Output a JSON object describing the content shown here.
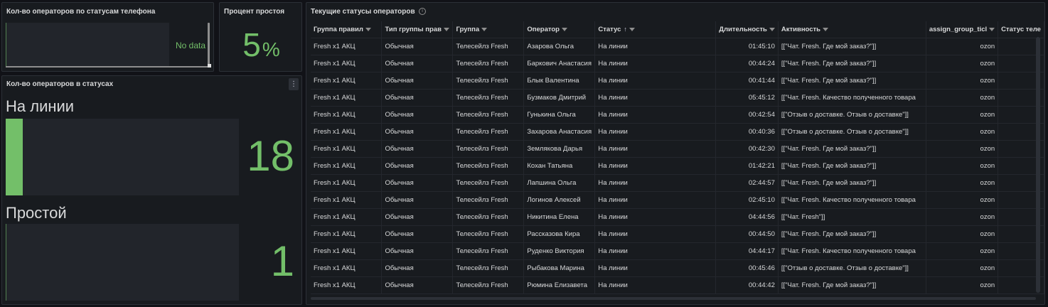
{
  "panel_phone_status": {
    "title": "Кол-во операторов по статусам телефона",
    "no_data": "No data"
  },
  "panel_idle": {
    "title": "Процент простоя",
    "value": "5",
    "unit": "%"
  },
  "panel_status_counts": {
    "title": "Кол-во операторов в статусах",
    "menu": "⋮",
    "items": [
      {
        "label": "На линии",
        "value": "18",
        "fill_fraction": 1.0
      },
      {
        "label": "Простой",
        "value": "1",
        "fill_fraction": 0.0
      }
    ],
    "accent": "#73bf69"
  },
  "panel_table": {
    "title": "Текущие статусы операторов",
    "info": "i",
    "columns": [
      "Группа правил",
      "Тип группы прав",
      "Группа",
      "Оператор",
      "Статус",
      "Длительность",
      "Активность",
      "assign_group_ticl",
      "Статус теле"
    ],
    "rows": [
      [
        "Fresh x1 АКЦ",
        "Обычная",
        "Телесейлз Fresh",
        "Азарова Ольга",
        "На линии",
        "01:45:10",
        "[[\"Чат. Fresh. Где мой заказ?\"]]",
        "ozon",
        ""
      ],
      [
        "Fresh x1 АКЦ",
        "Обычная",
        "Телесейлз Fresh",
        "Баркович Анастасия",
        "На линии",
        "00:44:24",
        "[[\"Чат. Fresh. Где мой заказ?\"]]",
        "ozon",
        ""
      ],
      [
        "Fresh x1 АКЦ",
        "Обычная",
        "Телесейлз Fresh",
        "Блык Валентина",
        "На линии",
        "00:41:44",
        "[[\"Чат. Fresh. Где мой заказ?\"]]",
        "ozon",
        ""
      ],
      [
        "Fresh x1 АКЦ",
        "Обычная",
        "Телесейлз Fresh",
        "Бузмаков Дмитрий",
        "На линии",
        "05:45:12",
        "[[\"Чат. Fresh. Качество полученного товара",
        "ozon",
        ""
      ],
      [
        "Fresh x1 АКЦ",
        "Обычная",
        "Телесейлз Fresh",
        "Гунькина Ольга",
        "На линии",
        "00:42:54",
        "[[\"Отзыв о доставке. Отзыв о доставке\"]]",
        "ozon",
        ""
      ],
      [
        "Fresh x1 АКЦ",
        "Обычная",
        "Телесейлз Fresh",
        "Захарова Анастасия",
        "На линии",
        "00:40:36",
        "[[\"Отзыв о доставке. Отзыв о доставке\"]]",
        "ozon",
        ""
      ],
      [
        "Fresh x1 АКЦ",
        "Обычная",
        "Телесейлз Fresh",
        "Землякова Дарья",
        "На линии",
        "00:42:30",
        "[[\"Чат. Fresh. Где мой заказ?\"]]",
        "ozon",
        ""
      ],
      [
        "Fresh x1 АКЦ",
        "Обычная",
        "Телесейлз Fresh",
        "Кохан Татьяна",
        "На линии",
        "01:42:21",
        "[[\"Чат. Fresh. Где мой заказ?\"]]",
        "ozon",
        ""
      ],
      [
        "Fresh x1 АКЦ",
        "Обычная",
        "Телесейлз Fresh",
        "Лапшина Ольга",
        "На линии",
        "02:44:57",
        "[[\"Чат. Fresh. Где мой заказ?\"]]",
        "ozon",
        ""
      ],
      [
        "Fresh x1 АКЦ",
        "Обычная",
        "Телесейлз Fresh",
        "Логинов Алексей",
        "На линии",
        "02:45:10",
        "[[\"Чат. Fresh. Качество полученного товара",
        "ozon",
        ""
      ],
      [
        "Fresh x1 АКЦ",
        "Обычная",
        "Телесейлз Fresh",
        "Никитина Елена",
        "На линии",
        "04:44:56",
        "[[\"Чат. Fresh\"]]",
        "ozon",
        ""
      ],
      [
        "Fresh x1 АКЦ",
        "Обычная",
        "Телесейлз Fresh",
        "Рассказова Кира",
        "На линии",
        "00:44:50",
        "[[\"Чат. Fresh. Где мой заказ?\"]]",
        "ozon",
        ""
      ],
      [
        "Fresh x1 АКЦ",
        "Обычная",
        "Телесейлз Fresh",
        "Руденко Виктория",
        "На линии",
        "04:44:17",
        "[[\"Чат. Fresh. Качество полученного товара",
        "ozon",
        ""
      ],
      [
        "Fresh x1 АКЦ",
        "Обычная",
        "Телесейлз Fresh",
        "Рыбакова Марина",
        "На линии",
        "00:45:46",
        "[[\"Отзыв о доставке. Отзыв о доставке\"]]",
        "ozon",
        ""
      ],
      [
        "Fresh x1 АКЦ",
        "Обычная",
        "Телесейлз Fresh",
        "Рюмина Елизавета",
        "На линии",
        "00:44:42",
        "[[\"Чат. Fresh. Где мой заказ?\"]]",
        "ozon",
        ""
      ]
    ]
  }
}
